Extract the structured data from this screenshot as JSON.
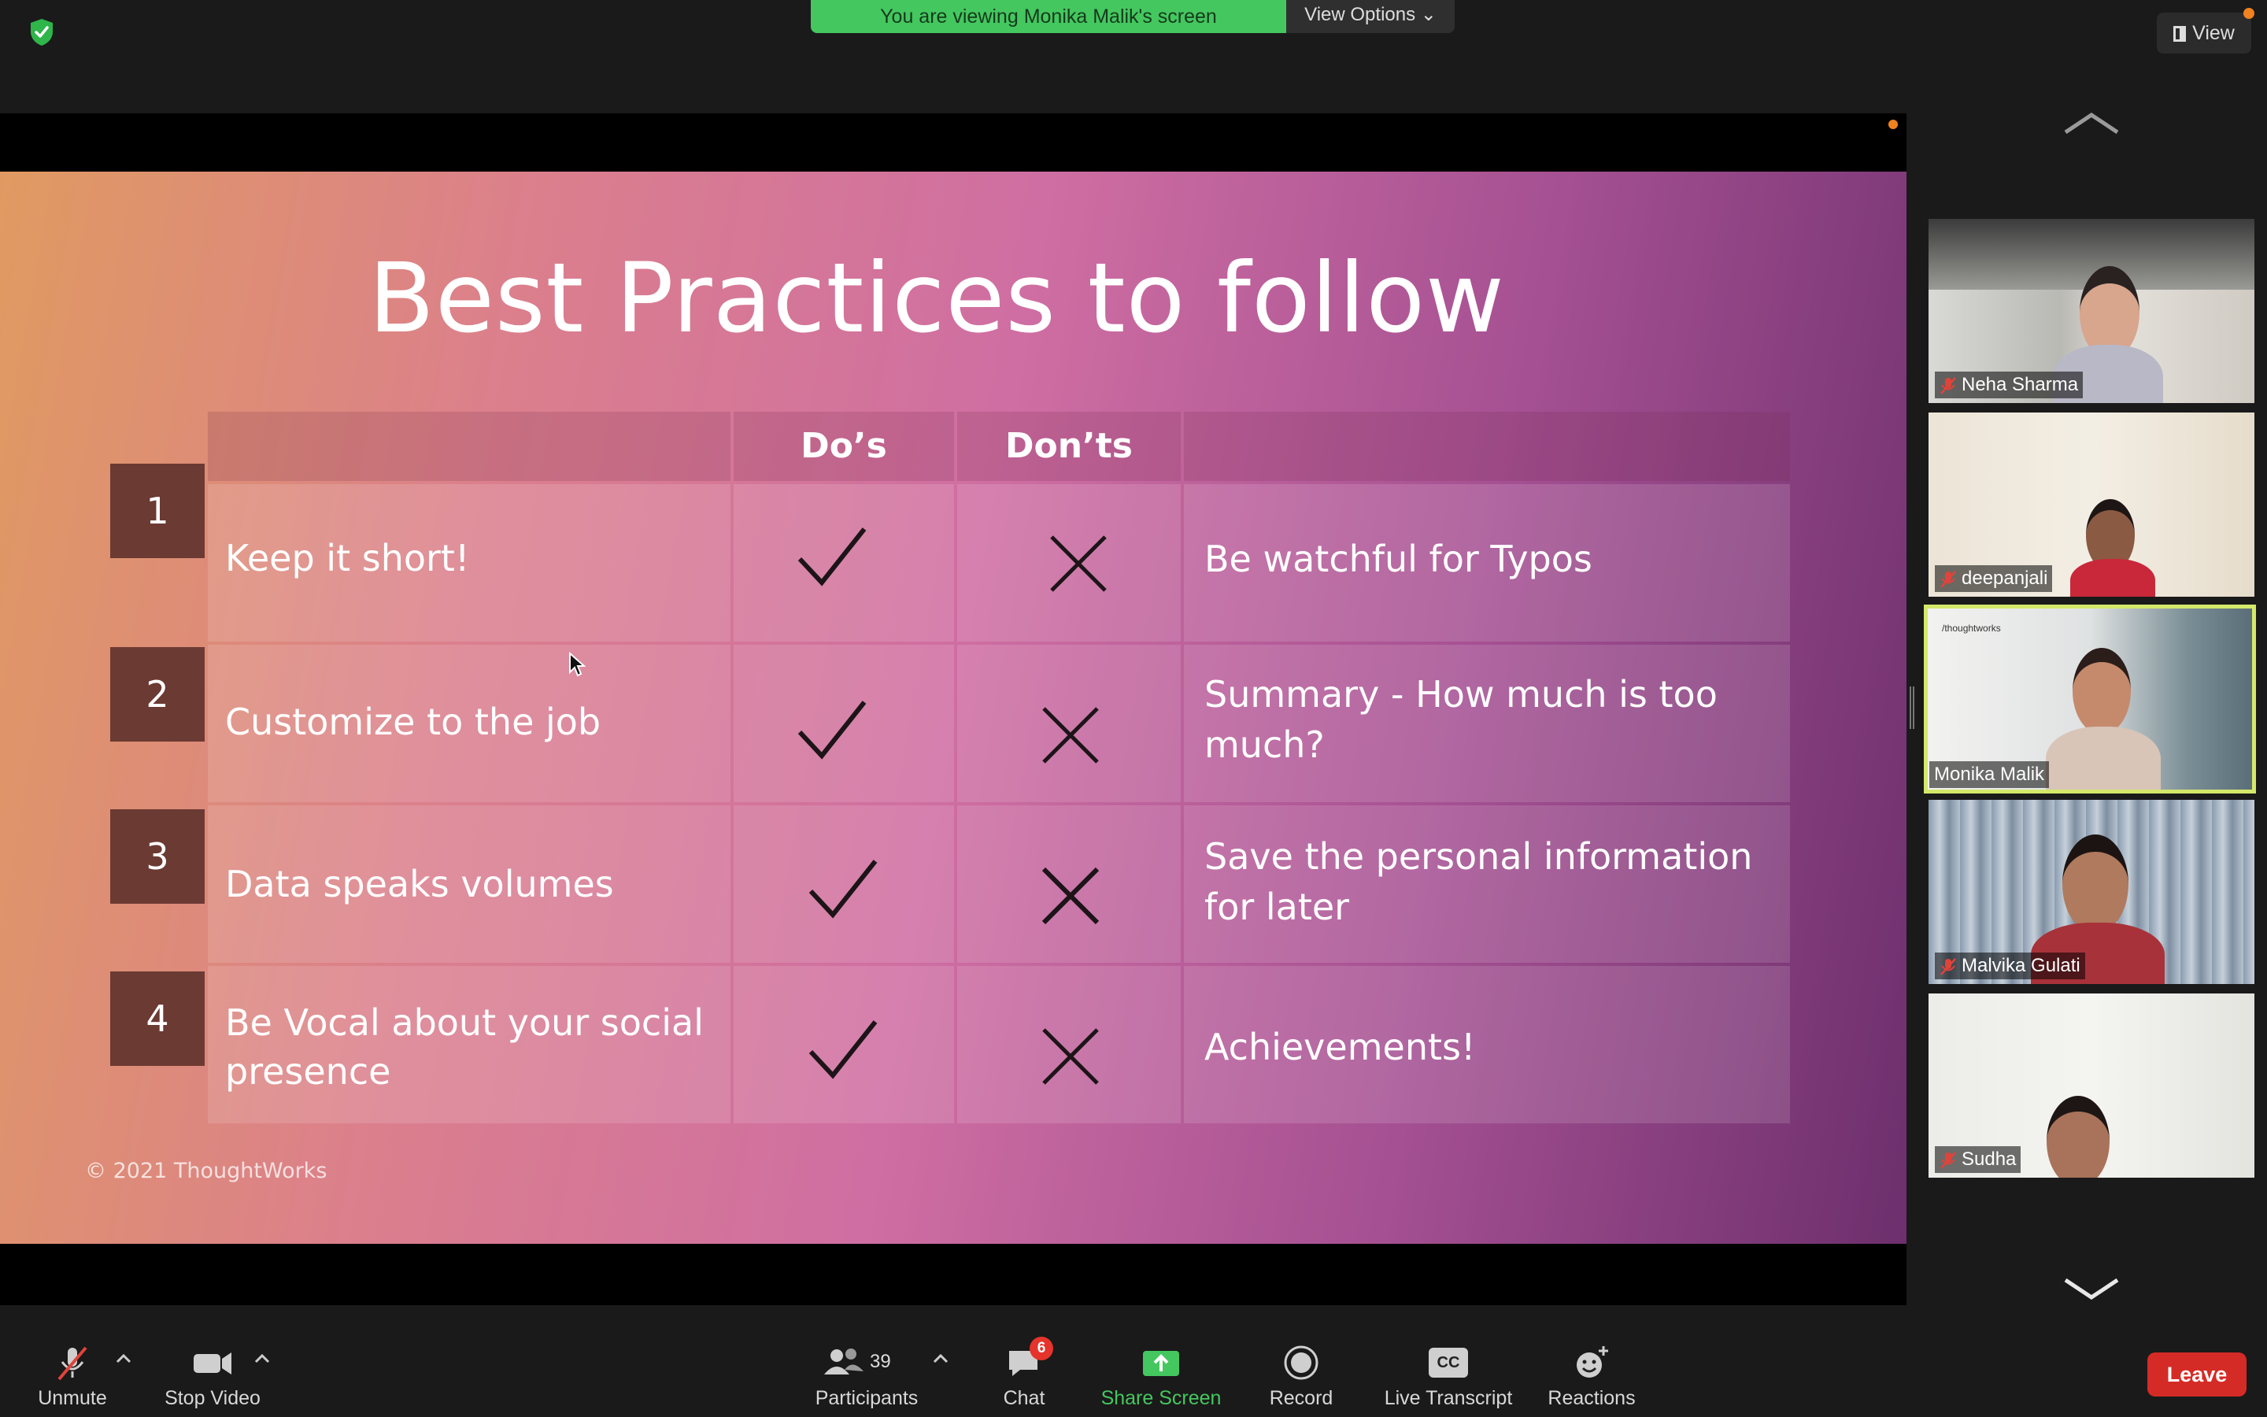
{
  "banner": {
    "text": "You are viewing Monika Malik's screen",
    "view_options": "View Options ⌄"
  },
  "view_button": {
    "label": "View"
  },
  "slide": {
    "title": "Best Practices to follow",
    "headers": {
      "dos": "Do’s",
      "donts": "Don’ts"
    },
    "rows": [
      {
        "num": "1",
        "text": "Keep it short!",
        "note": "Be watchful for Typos"
      },
      {
        "num": "2",
        "text": "Customize to the job",
        "note": "Summary - How much is too much?"
      },
      {
        "num": "3",
        "text": "Data speaks volumes",
        "note": "Save the personal information for later"
      },
      {
        "num": "4",
        "text": "Be Vocal about your social presence",
        "note": "Achievements!"
      }
    ],
    "copyright": "© 2021 ThoughtWorks"
  },
  "participants_panel": {
    "tiles": [
      {
        "name": "Neha Sharma",
        "muted": true,
        "active": false
      },
      {
        "name": "deepanjali",
        "muted": true,
        "active": false
      },
      {
        "name": "Monika Malik",
        "muted": false,
        "active": true,
        "logo": "/thoughtworks"
      },
      {
        "name": "Malvika Gulati",
        "muted": true,
        "active": false
      },
      {
        "name": "Sudha",
        "muted": true,
        "active": false
      }
    ]
  },
  "toolbar": {
    "unmute": "Unmute",
    "stop_video": "Stop Video",
    "participants": "Participants",
    "participants_count": "39",
    "chat": "Chat",
    "chat_badge": "6",
    "share_screen": "Share Screen",
    "record": "Record",
    "live_transcript": "Live Transcript",
    "cc_icon": "CC",
    "reactions": "Reactions",
    "leave": "Leave"
  },
  "colors": {
    "share_green": "#44c75f",
    "leave_red": "#d52b26",
    "active_border": "#d4e86a"
  }
}
